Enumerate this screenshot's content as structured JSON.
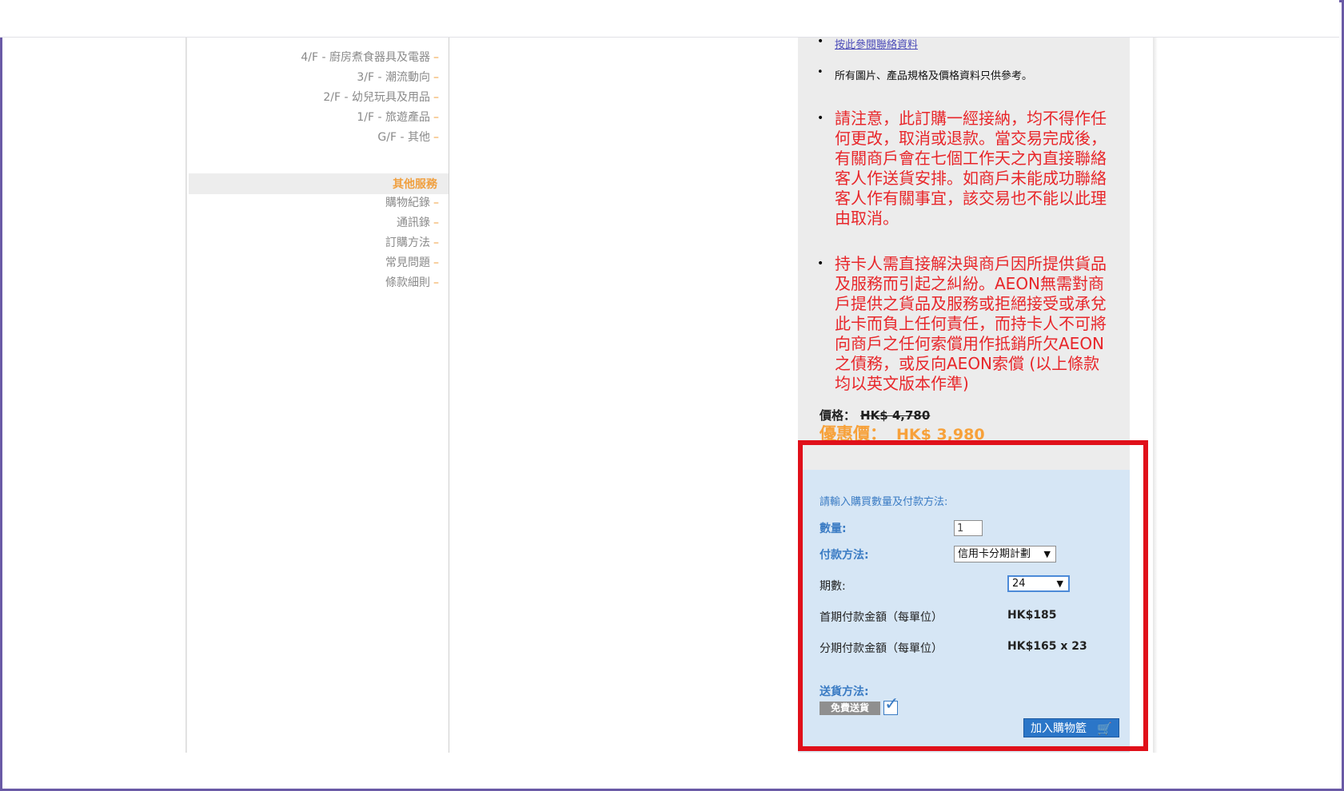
{
  "sidebar": {
    "floors": [
      {
        "label": "4/F - 廚房煮食器具及電器"
      },
      {
        "label": "3/F - 潮流動向"
      },
      {
        "label": "2/F - 幼兒玩具及用品"
      },
      {
        "label": "1/F - 旅遊產品"
      },
      {
        "label": "G/F - 其他"
      }
    ],
    "other_header": "其他服務",
    "services": [
      {
        "label": "購物紀錄"
      },
      {
        "label": "通訊錄"
      },
      {
        "label": "訂購方法"
      },
      {
        "label": "常見問題"
      },
      {
        "label": "條款細則"
      }
    ],
    "dash": "–"
  },
  "content": {
    "contact_link": "按此參閱聯絡資料",
    "ref_note": "所有圖片、產品規格及價格資料只供參考。",
    "notice_1": "請注意，此訂購一經接納，均不得作任何更改，取消或退款。當交易完成後，有關商戶會在七個工作天之內直接聯絡客人作送貨安排。如商戶未能成功聯絡客人作有關事宜，該交易也不能以此理由取消。",
    "notice_2": "持卡人需直接解決與商戶因所提供貨品及服務而引起之糾紛。AEON無需對商戶提供之貨品及服務或拒絕接受或承兌此卡而負上任何責任，而持卡人不可將向商戶之任何索償用作抵銷所欠AEON之債務，或反向AEON索償 (以上條款均以英文版本作準)",
    "price_label": "價格：",
    "price_value": "HK$ 4,780",
    "sale_label": "優惠價：",
    "sale_value": "HK$ 3,980"
  },
  "order": {
    "intro": "請輸入購買數量及付款方法:",
    "qty_label": "數量:",
    "qty_value": "1",
    "payment_label": "付款方法:",
    "payment_value": "信用卡分期計劃",
    "term_label": "期數:",
    "term_value": "24",
    "first_label": "首期付款金額（每單位）",
    "first_value": "HK$185",
    "install_label": "分期付款金額（每單位）",
    "install_value": "HK$165 x 23",
    "delivery_label": "送貨方法:",
    "free_ship": "免費送貨",
    "cart_button": "加入購物籃"
  },
  "colors": {
    "accent_orange": "#f0a040",
    "notice_red": "#e8262a",
    "highlight_frame": "#e0101a",
    "order_bg": "#d6e6f5",
    "label_blue": "#3b7cc4"
  }
}
